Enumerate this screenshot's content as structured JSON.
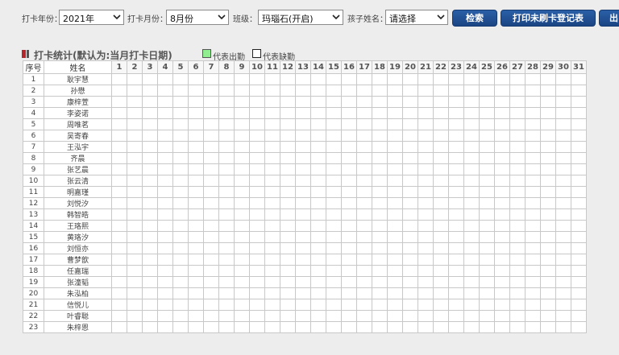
{
  "filters": {
    "year_label": "打卡年份：",
    "year_value": "2021年",
    "month_label": "打卡月份：",
    "month_value": "8月份",
    "class_label": "班级：",
    "class_value": "玛瑙石(开启)",
    "child_label": "孩子姓名：",
    "child_value": "请选择"
  },
  "buttons": {
    "search": "检索",
    "print": "打印未刷卡登记表",
    "export": "出"
  },
  "section": {
    "title": "打卡统计(默认为:当月打卡日期)",
    "legend_present": "代表出勤",
    "legend_absent": "代表缺勤"
  },
  "colors": {
    "button": "#1f4e8f",
    "present": "#90ee90",
    "absent": "#ffffff",
    "marker_red": "#b3262b",
    "marker_dark": "#555555"
  },
  "table": {
    "header_no": "序号",
    "header_name": "姓名",
    "days": [
      "1",
      "2",
      "3",
      "4",
      "5",
      "6",
      "7",
      "8",
      "9",
      "10",
      "11",
      "12",
      "13",
      "14",
      "15",
      "16",
      "17",
      "18",
      "19",
      "20",
      "21",
      "22",
      "23",
      "24",
      "25",
      "26",
      "27",
      "28",
      "29",
      "30",
      "31"
    ],
    "rows": [
      {
        "no": "1",
        "name": "耿宇慧"
      },
      {
        "no": "2",
        "name": "孙懋"
      },
      {
        "no": "3",
        "name": "康梓萱"
      },
      {
        "no": "4",
        "name": "李姿诺"
      },
      {
        "no": "5",
        "name": "周唯茗"
      },
      {
        "no": "6",
        "name": "吴寄春"
      },
      {
        "no": "7",
        "name": "王泓宇"
      },
      {
        "no": "8",
        "name": "齐晨"
      },
      {
        "no": "9",
        "name": "张艺晨"
      },
      {
        "no": "10",
        "name": "张云清"
      },
      {
        "no": "11",
        "name": "明嘉瑾"
      },
      {
        "no": "12",
        "name": "刘悦汐"
      },
      {
        "no": "13",
        "name": "韩智皓"
      },
      {
        "no": "14",
        "name": "王珞熙"
      },
      {
        "no": "15",
        "name": "黄珞汐"
      },
      {
        "no": "16",
        "name": "刘恒亦"
      },
      {
        "no": "17",
        "name": "曹梦歆"
      },
      {
        "no": "18",
        "name": "任嘉瑞"
      },
      {
        "no": "19",
        "name": "张潼韬"
      },
      {
        "no": "20",
        "name": "朱泓柏"
      },
      {
        "no": "21",
        "name": "信悦儿"
      },
      {
        "no": "22",
        "name": "叶睿聪"
      },
      {
        "no": "23",
        "name": "朱梓恩"
      }
    ]
  }
}
